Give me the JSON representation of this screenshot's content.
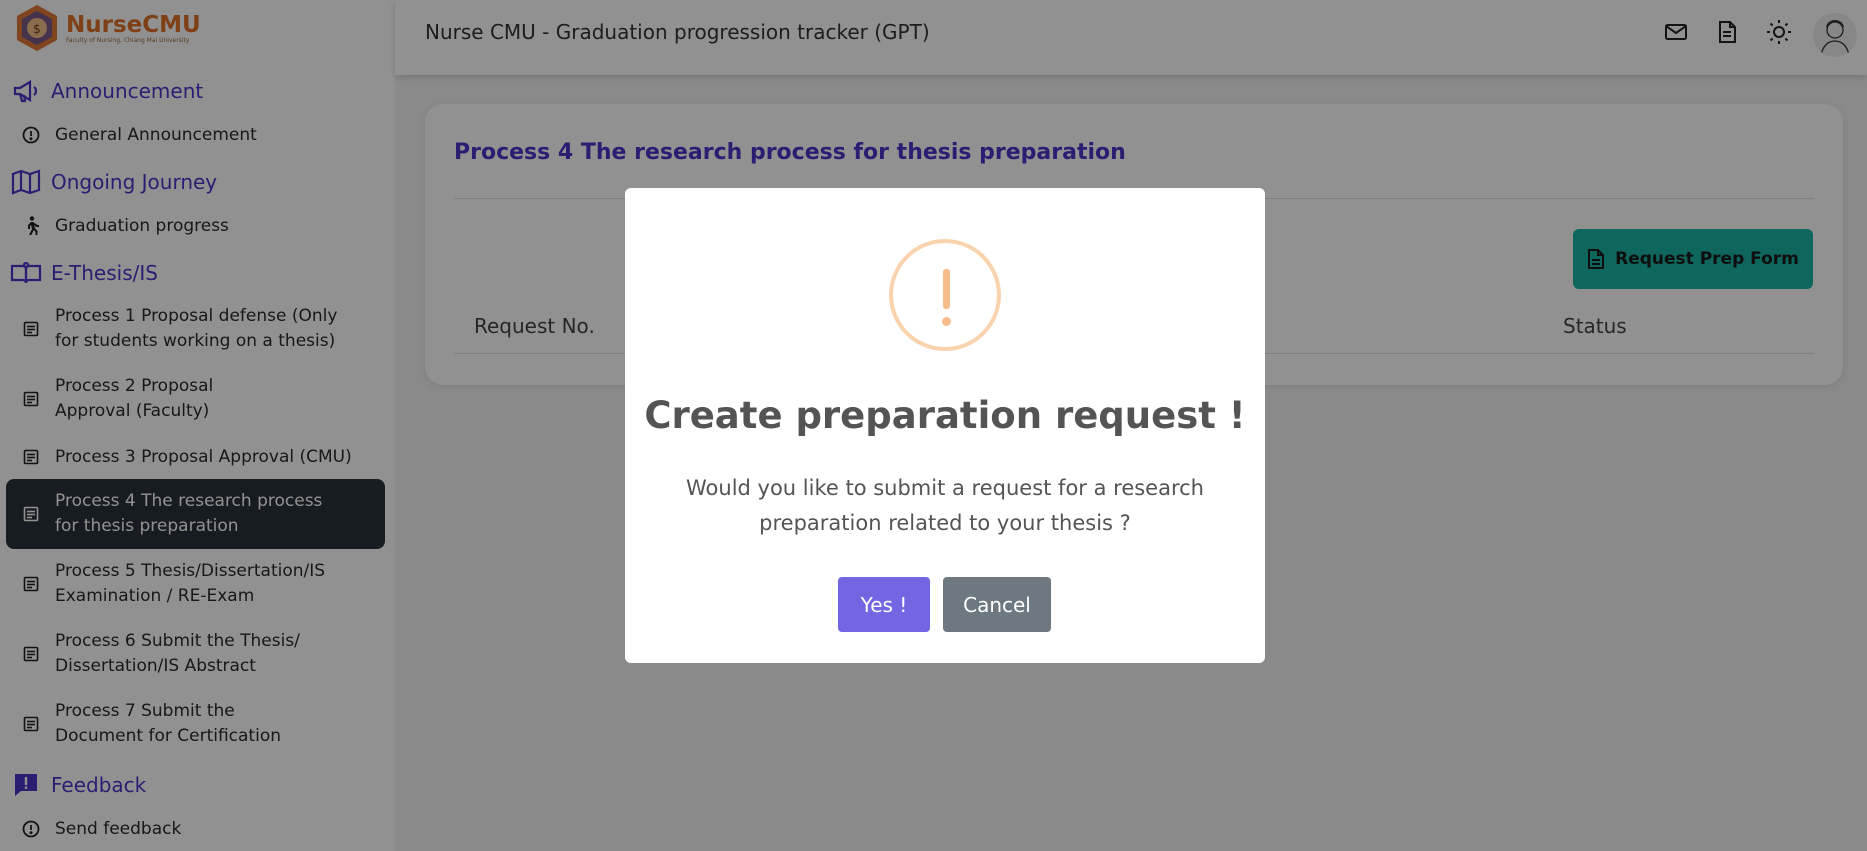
{
  "brand": {
    "name": "NurseCMU",
    "subtitle": "Faculty of Nursing, Chiang Mai University"
  },
  "topbar": {
    "title": "Nurse CMU - Graduation progression tracker (GPT)"
  },
  "sidebar": {
    "sections": [
      {
        "label": "Announcement",
        "icon": "megaphone-icon"
      },
      {
        "label": "Ongoing Journey",
        "icon": "map-icon"
      },
      {
        "label": "E-Thesis/IS",
        "icon": "book-reader-icon"
      },
      {
        "label": "Feedback",
        "icon": "feedback-icon"
      }
    ],
    "items": [
      {
        "label": "General Announcement",
        "icon": "info-circle-icon"
      },
      {
        "label": "Graduation progress",
        "icon": "walking-icon"
      },
      {
        "label": "Process 1 Proposal defense (Only for students working on a thesis)",
        "icon": "document-icon"
      },
      {
        "label": "Process 2 Proposal Approval (Faculty)",
        "icon": "document-icon"
      },
      {
        "label": "Process 3 Proposal Approval (CMU)",
        "icon": "document-icon"
      },
      {
        "label": "Process 4 The research process for thesis preparation",
        "icon": "document-icon",
        "active": true
      },
      {
        "label": "Process 5 Thesis/Dissertation/IS Examination / RE-Exam",
        "icon": "document-icon"
      },
      {
        "label": "Process 6 Submit the Thesis/ Dissertation/IS Abstract",
        "icon": "document-icon"
      },
      {
        "label": "Process 7 Submit the Document for Certification",
        "icon": "document-icon"
      },
      {
        "label": "Send feedback",
        "icon": "info-circle-icon"
      }
    ]
  },
  "card": {
    "title": "Process 4 The research process for thesis preparation",
    "request_button": "Request Prep Form",
    "columns": [
      "Request No.",
      "Status"
    ]
  },
  "modal": {
    "title": "Create preparation request !",
    "text": "Would you like to submit a request for a research preparation related to your thesis ?",
    "yes_label": "Yes !",
    "cancel_label": "Cancel"
  },
  "colors": {
    "accent": "#4a35c8",
    "teal": "#19b3a4",
    "confirm": "#7266e2",
    "cancel": "#6e7881",
    "active_nav": "#29323e",
    "warning": "#f8d3ae"
  }
}
